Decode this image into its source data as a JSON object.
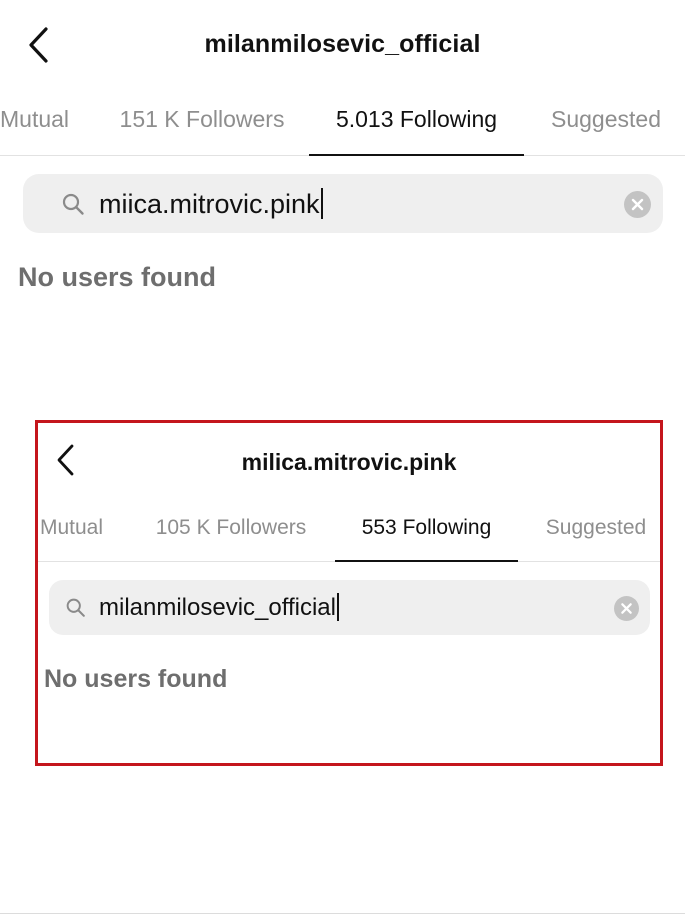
{
  "main": {
    "header": {
      "title": "milanmilosevic_official"
    },
    "tabs": [
      {
        "label": "Mutual",
        "active": false
      },
      {
        "label": "151 K Followers",
        "active": false
      },
      {
        "label": "5.013 Following",
        "active": true
      },
      {
        "label": "Suggested",
        "active": false
      }
    ],
    "search": {
      "value": "miica.mitrovic.pink"
    },
    "empty_message": "No users found"
  },
  "inset": {
    "header": {
      "title": "milica.mitrovic.pink"
    },
    "tabs": [
      {
        "label": "Mutual",
        "active": false
      },
      {
        "label": "105 K Followers",
        "active": false
      },
      {
        "label": "553 Following",
        "active": true
      },
      {
        "label": "Suggested",
        "active": false
      }
    ],
    "search": {
      "value": "milanmilosevic_official"
    },
    "empty_message": "No users found"
  },
  "icons": {
    "back": "chevron-left-icon",
    "search": "search-icon",
    "clear": "clear-circle-icon"
  },
  "colors": {
    "highlight_border": "#c4161c",
    "search_background": "#efefef",
    "inactive_tab": "#8e8e8e",
    "active_tab": "#111111",
    "empty_message": "#6e6e6e"
  }
}
